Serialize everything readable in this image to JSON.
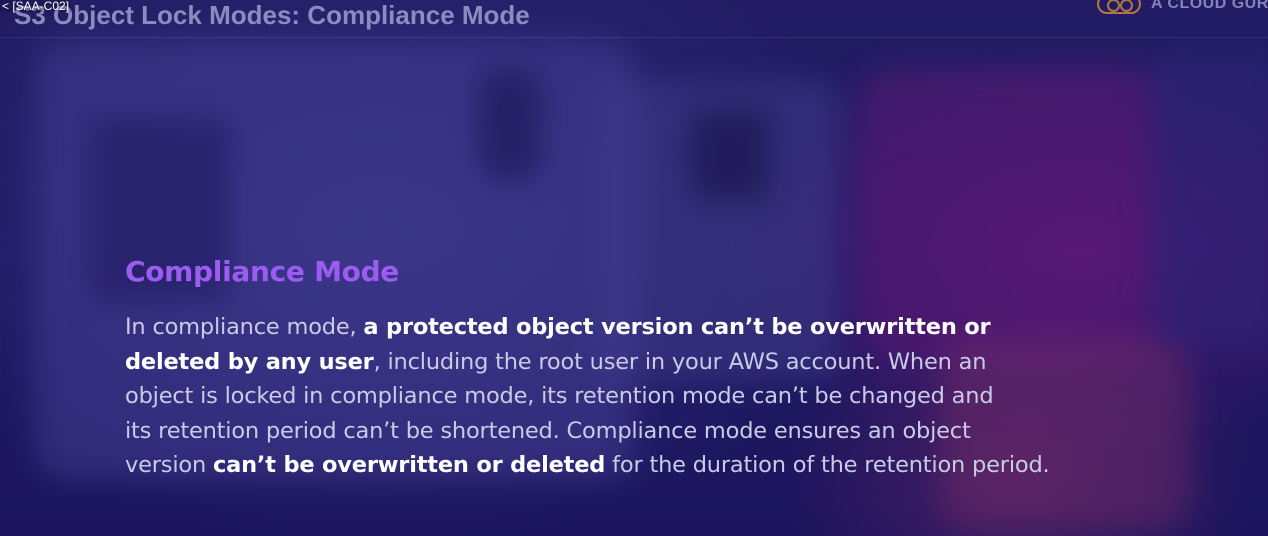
{
  "window_caption": "< [SAA-C02]",
  "slide_title": "S3 Object Lock Modes: Compliance Mode",
  "brand": {
    "name": "A CLOUD GUR",
    "logo_icon": "acg-logo-icon",
    "logo_color": "#dc963c"
  },
  "colors": {
    "heading": "#9b5cf2",
    "body_text": "#c9cbe6",
    "bold_text": "#ffffff",
    "background": "#1e1a5c"
  },
  "content": {
    "heading": "Compliance Mode",
    "lines": [
      [
        {
          "text": "In compliance mode, ",
          "bold": false
        },
        {
          "text": "a protected object version can’t be overwritten or",
          "bold": true
        }
      ],
      [
        {
          "text": "deleted by any user",
          "bold": true
        },
        {
          "text": ", including the root user in your AWS account. When an",
          "bold": false
        }
      ],
      [
        {
          "text": "object is locked in compliance mode, its retention mode can’t be changed and",
          "bold": false
        }
      ],
      [
        {
          "text": "its retention period can’t be shortened. Compliance mode ensures an object",
          "bold": false
        }
      ],
      [
        {
          "text": "version ",
          "bold": false
        },
        {
          "text": "can’t be overwritten or deleted",
          "bold": true
        },
        {
          "text": " for the duration of the retention period.",
          "bold": false
        }
      ]
    ]
  }
}
